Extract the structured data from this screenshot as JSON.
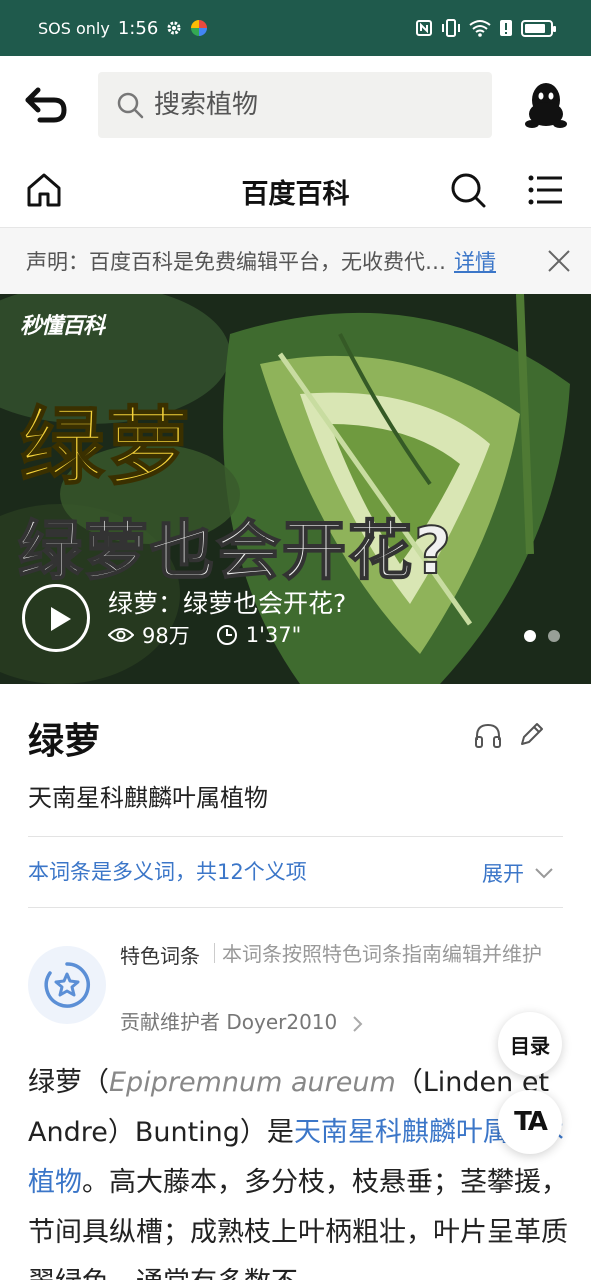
{
  "status_bar": {
    "carrier": "SOS only",
    "time": "1:56",
    "battery_level": 0.85,
    "icons": [
      "gear-icon",
      "app-icon",
      "nfc-icon",
      "vibrate-icon",
      "wifi-icon",
      "alert-icon",
      "battery-icon"
    ]
  },
  "header": {
    "search_placeholder": "搜索植物",
    "icons": [
      "back-icon",
      "search-icon",
      "qq-avatar-icon"
    ]
  },
  "nav": {
    "title": "百度百科",
    "icons": [
      "home-icon",
      "search-icon",
      "menu-icon"
    ]
  },
  "notice": {
    "text": "声明：百度百科是免费编辑平台，无收费代…",
    "link": "详情"
  },
  "video": {
    "logo": "秒懂百科",
    "headline_1": "绿萝",
    "headline_2": "绿萝也会开花?",
    "caption": "绿萝：绿萝也会开花?",
    "views": "98万",
    "duration": "1'37\"",
    "slide_count": 2,
    "active_slide": 1
  },
  "entry": {
    "title": "绿萝",
    "subtitle": "天南星科麒麟叶属植物",
    "polysemy": "本词条是多义词，共12个义项",
    "expand": "展开"
  },
  "featured": {
    "label": "特色词条",
    "desc": "本词条按照特色词条指南编辑并维护",
    "maintainer": "贡献维护者 Doyer2010"
  },
  "body": {
    "p1": "绿萝（",
    "latin": "Epipremnum aureum",
    "p2": "（Linden et Andre）Bunting）是",
    "link": "天南星科麒麟叶属藤本植物",
    "p3": "。高大藤本，多分枝，枝悬垂；茎攀援，节间具纵槽；成熟枝上叶柄粗壮，叶片呈革质翠绿色，通常有多数不"
  },
  "floating": {
    "toc": "目录",
    "ta": "TA"
  }
}
